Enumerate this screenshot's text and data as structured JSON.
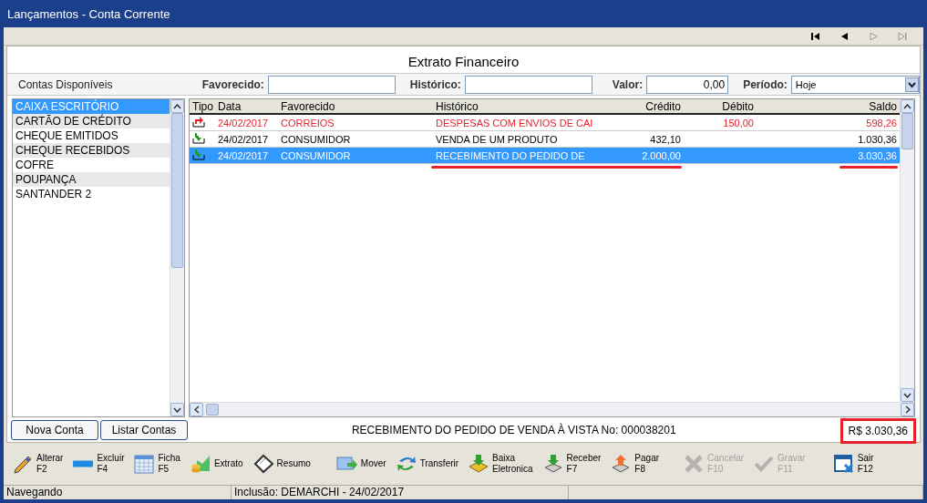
{
  "window": {
    "title": "Lançamentos - Conta Corrente"
  },
  "nav_buttons": [
    {
      "disabled": false
    },
    {
      "disabled": false
    },
    {
      "disabled": true
    },
    {
      "disabled": true
    }
  ],
  "heading": "Extrato Financeiro",
  "accounts_label": "Contas Disponíveis",
  "filters": [
    {
      "label": "Favorecido:"
    },
    {
      "label": "Histórico:"
    },
    {
      "label": "Valor:",
      "value": "0,00"
    }
  ],
  "period": {
    "label": "Período:",
    "value": "Hoje"
  },
  "accounts": [
    {
      "name": "CAIXA ESCRITÓRIO",
      "selected": true
    },
    {
      "name": "CARTÃO DE CRÉDITO",
      "selected": false
    },
    {
      "name": "CHEQUE EMITIDOS",
      "selected": false
    },
    {
      "name": "CHEQUE RECEBIDOS",
      "selected": false
    },
    {
      "name": "COFRE",
      "selected": false
    },
    {
      "name": "POUPANÇA",
      "selected": false
    },
    {
      "name": "SANTANDER 2",
      "selected": false
    }
  ],
  "table": {
    "columns": [
      "Tipo",
      "Data",
      "Favorecido",
      "Histórico",
      "Crédito",
      "Débito",
      "Saldo"
    ],
    "rows": [
      {
        "kind": "debit",
        "selected": false,
        "date": "24/02/2017",
        "payee": "CORREIOS",
        "history": "DESPESAS COM ENVIOS DE CAI",
        "credit": "",
        "debit": "150,00",
        "balance": "598,26"
      },
      {
        "kind": "credit",
        "selected": false,
        "date": "24/02/2017",
        "payee": "CONSUMIDOR",
        "history": "VENDA DE UM PRODUTO",
        "credit": "432,10",
        "debit": "",
        "balance": "1.030,36"
      },
      {
        "kind": "credit",
        "selected": true,
        "date": "24/02/2017",
        "payee": "CONSUMIDOR",
        "history": "RECEBIMENTO DO PEDIDO DE",
        "credit": "2.000,00",
        "debit": "",
        "balance": "3.030,36"
      }
    ]
  },
  "account_buttons": [
    "Nova Conta",
    "Listar Contas"
  ],
  "detail": "RECEBIMENTO DO PEDIDO DE VENDA À VISTA No: 000038201",
  "total": "R$ 3.030,36",
  "toolbar": [
    {
      "label": "Alterar",
      "key": "F2",
      "disabled": false
    },
    {
      "label": "Excluir",
      "key": "F4",
      "disabled": false
    },
    {
      "label": "Ficha",
      "key": "F5",
      "disabled": false
    },
    {
      "label": "Extrato",
      "disabled": false
    },
    {
      "label": "Resumo",
      "disabled": false
    },
    {
      "label": "Mover",
      "disabled": false
    },
    {
      "label": "Transferir",
      "disabled": false
    },
    {
      "label": "Baixa",
      "key": "Eletronica",
      "disabled": false
    },
    {
      "label": "Receber",
      "key": "F7",
      "disabled": false
    },
    {
      "label": "Pagar",
      "key": "F8",
      "disabled": false
    },
    {
      "label": "Cancelar",
      "key": "F10",
      "disabled": true
    },
    {
      "label": "Gravar",
      "key": "F11",
      "disabled": true
    },
    {
      "label": "Sair",
      "key": "F12",
      "disabled": false
    }
  ],
  "status_bar": [
    "Navegando",
    "Inclusão: DEMARCHI - 24/02/2017"
  ]
}
